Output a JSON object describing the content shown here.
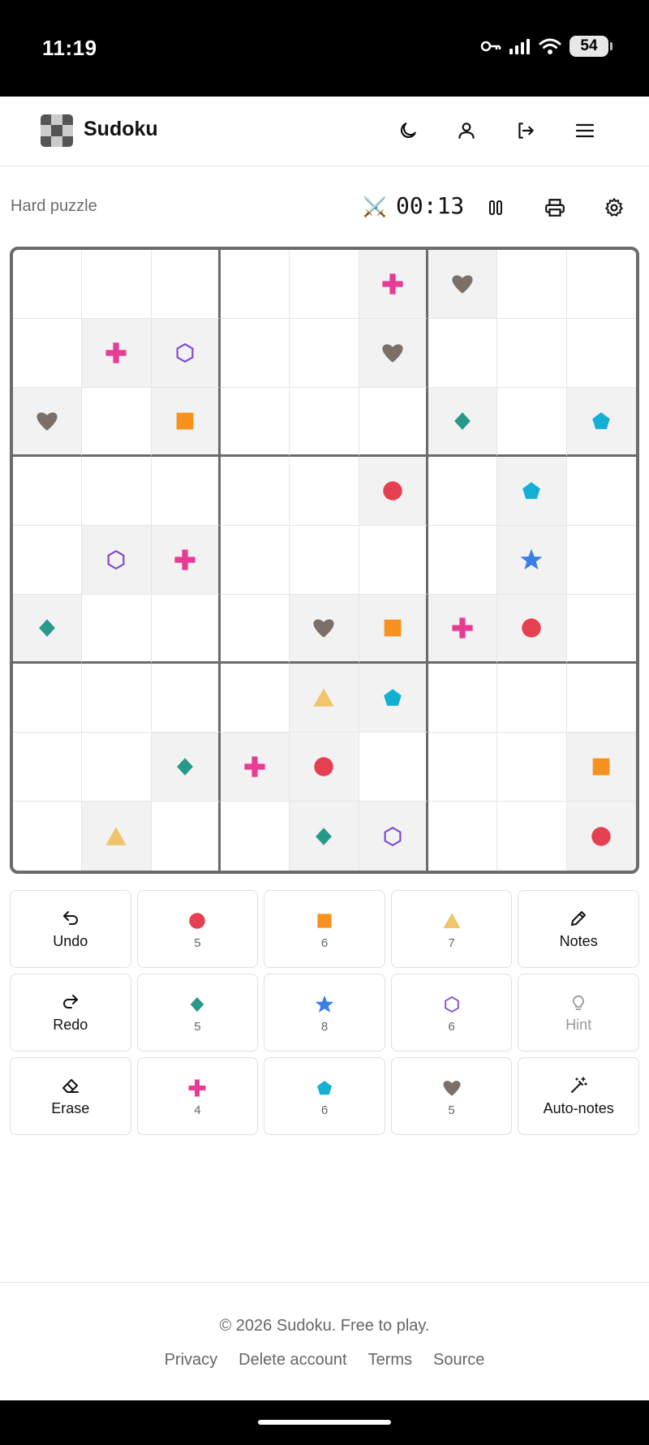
{
  "status_bar": {
    "time": "11:19",
    "battery": "54"
  },
  "header": {
    "title": "Sudoku"
  },
  "toolbar": {
    "difficulty": "Hard puzzle",
    "timer": "00:13",
    "timer_icon": "⚔️"
  },
  "symbols": {
    "circle": {
      "color": "#e5404f",
      "count": "5"
    },
    "square": {
      "color": "#f7921e",
      "count": "6"
    },
    "triangle": {
      "color": "#eec56a",
      "count": "7"
    },
    "diamond": {
      "color": "#26998a",
      "count": "5"
    },
    "star": {
      "color": "#3a7fe8",
      "count": "8"
    },
    "hexagon": {
      "color": "#7b48d8",
      "count": "6"
    },
    "cross": {
      "color": "#e63c93",
      "count": "4"
    },
    "pentagon": {
      "color": "#14b0d4",
      "count": "6"
    },
    "heart": {
      "color": "#7a7068",
      "count": "5"
    }
  },
  "board": [
    [
      "",
      "",
      "",
      "",
      "",
      "cross",
      "heart",
      "",
      ""
    ],
    [
      "",
      "cross",
      "hexagon",
      "",
      "",
      "heart",
      "",
      "",
      ""
    ],
    [
      "heart",
      "",
      "square",
      "",
      "",
      "",
      "diamond",
      "",
      "pentagon"
    ],
    [
      "",
      "",
      "",
      "",
      "",
      "circle",
      "",
      "pentagon",
      ""
    ],
    [
      "",
      "hexagon",
      "cross",
      "",
      "",
      "",
      "",
      "star",
      ""
    ],
    [
      "diamond",
      "",
      "",
      "",
      "heart",
      "square",
      "cross",
      "circle",
      ""
    ],
    [
      "",
      "",
      "",
      "",
      "triangle",
      "pentagon",
      "",
      "",
      ""
    ],
    [
      "",
      "",
      "diamond",
      "cross",
      "circle",
      "",
      "",
      "",
      "square"
    ],
    [
      "",
      "triangle",
      "",
      "",
      "diamond",
      "hexagon",
      "",
      "",
      "circle"
    ]
  ],
  "keypad": {
    "undo": "Undo",
    "redo": "Redo",
    "erase": "Erase",
    "notes": "Notes",
    "hint": "Hint",
    "auto_notes": "Auto-notes"
  },
  "footer": {
    "copyright": "© 2026 Sudoku. Free to play.",
    "links": [
      "Privacy",
      "Delete account",
      "Terms",
      "Source"
    ]
  }
}
